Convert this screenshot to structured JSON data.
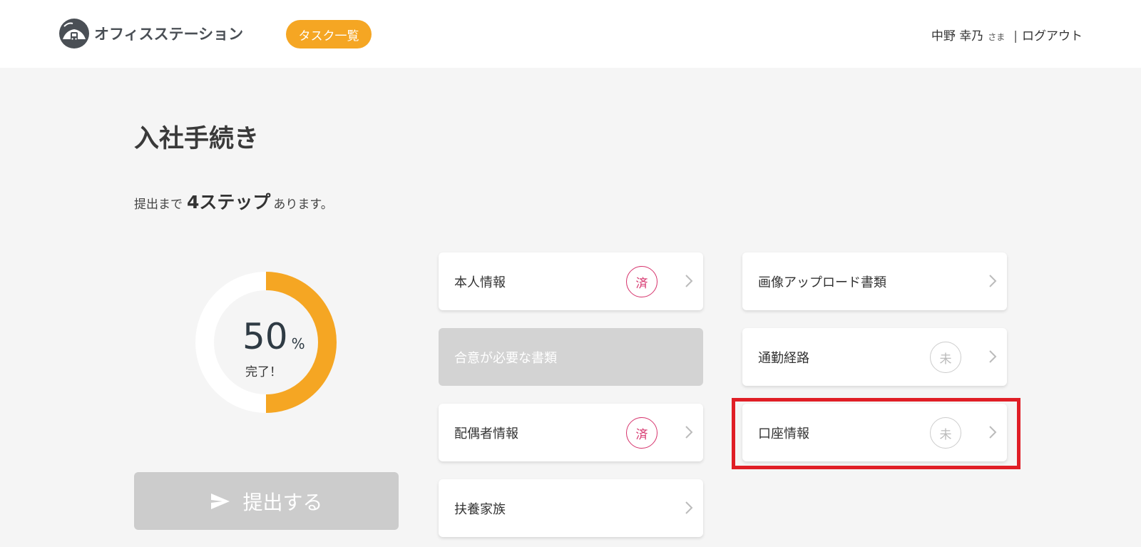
{
  "header": {
    "logo_text": "オフィスステーション",
    "task_button": "タスク一覧",
    "user_name": "中野 幸乃",
    "user_honorific": "さま",
    "separator": "|",
    "logout": "ログアウト"
  },
  "page": {
    "title": "入社手続き",
    "steps_prefix": "提出まで",
    "steps_count": "4ステップ",
    "steps_suffix": "あります。"
  },
  "progress": {
    "percent": 50,
    "percent_text": "50",
    "unit": "%",
    "label": "完了！",
    "colors": {
      "fill": "#f5a623",
      "track": "#ffffff"
    }
  },
  "submit": {
    "label": "提出する"
  },
  "cards": [
    {
      "label": "本人情報",
      "badge": "済",
      "status": "done"
    },
    {
      "label": "合意が必要な書類",
      "badge": "",
      "status": "disabled"
    },
    {
      "label": "配偶者情報",
      "badge": "済",
      "status": "done"
    },
    {
      "label": "扶養家族",
      "badge": "",
      "status": "none"
    },
    {
      "label": "画像アップロード書類",
      "badge": "",
      "status": "none"
    },
    {
      "label": "通勤経路",
      "badge": "未",
      "status": "pending"
    },
    {
      "label": "口座情報",
      "badge": "未",
      "status": "pending"
    }
  ],
  "colors": {
    "accent": "#f5a623",
    "done_badge": "#d6336c",
    "pending_badge": "#cccccc",
    "highlight": "#e01e26"
  }
}
